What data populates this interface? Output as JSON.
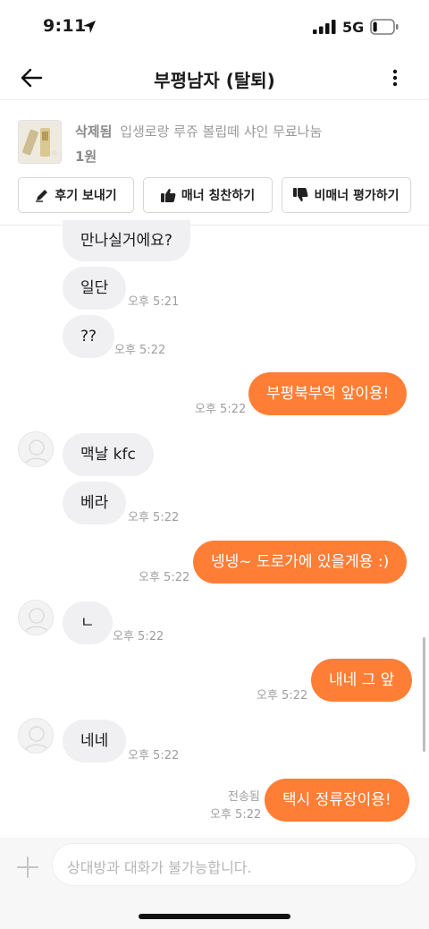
{
  "status_bar": {
    "time": "9:11",
    "network": "5G",
    "battery_level": 0.2
  },
  "header": {
    "title": "부평남자 (탈퇴)",
    "back_icon": "arrow-left-icon",
    "more_icon": "vertical-dots-icon"
  },
  "product": {
    "status": "삭제됨",
    "title": "입생로랑 루쥬 볼립떼 샤인 무료나눔",
    "price": "1원",
    "actions": [
      {
        "label": "후기 보내기",
        "icon": "pencil-icon"
      },
      {
        "label": "매너 칭찬하기",
        "icon": "thumbs-up-icon"
      },
      {
        "label": "비매너 평가하기",
        "icon": "thumbs-down-icon"
      }
    ]
  },
  "messages": [
    {
      "side": "received",
      "text": "만나실거에요?",
      "time": ""
    },
    {
      "side": "received",
      "text": "일단",
      "time": "오후 5:21"
    },
    {
      "side": "received",
      "text": "??",
      "time": "오후 5:22"
    },
    {
      "side": "sent",
      "text": "부평북부역 앞이용!",
      "time": "오후 5:22"
    },
    {
      "side": "received",
      "text": "맥날 kfc",
      "time": ""
    },
    {
      "side": "received",
      "text": "베라",
      "time": "오후 5:22"
    },
    {
      "side": "sent",
      "text": "넹넹~ 도로가에 있을게용 :)",
      "time": "오후 5:22"
    },
    {
      "side": "received",
      "text": "ㄴ",
      "time": "오후 5:22"
    },
    {
      "side": "sent",
      "text": "내네 그 앞",
      "time": "오후 5:22"
    },
    {
      "side": "received",
      "text": "네네",
      "time": "오후 5:22"
    },
    {
      "side": "sent",
      "text": "택시 정류장이용!",
      "time": "오후 5:22",
      "status": "전송됨"
    }
  ],
  "composer": {
    "placeholder": "상대방과 대화가 불가능합니다.",
    "plus_icon": "plus-icon"
  },
  "colors": {
    "accent": "#ff7e36",
    "received_bubble": "#f0f0f3"
  }
}
